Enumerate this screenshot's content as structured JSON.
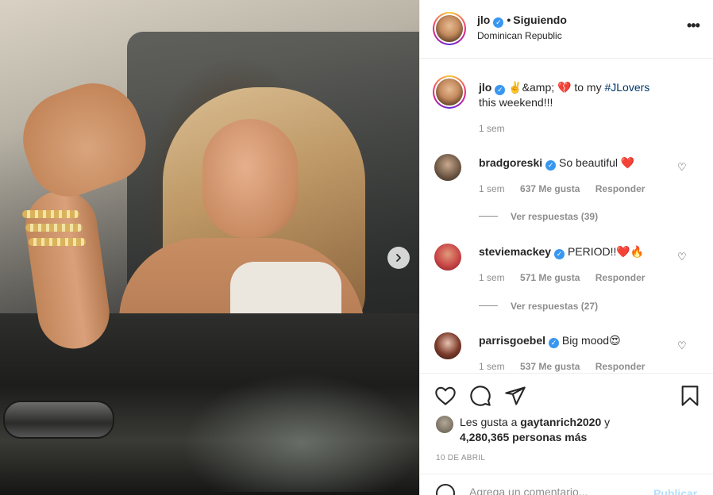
{
  "post": {
    "username": "jlo",
    "following_label": "Siguiendo",
    "location": "Dominican Republic",
    "more_icon": "•••"
  },
  "caption": {
    "username": "jlo",
    "emoji": "✌️&amp; 💔",
    "text_pre": " to my ",
    "hashtag": "#JLovers",
    "text_post": " this weekend!!!",
    "time": "1 sem"
  },
  "comments": [
    {
      "username": "bradgoreski",
      "text": "So beautiful ❤️",
      "time": "1 sem",
      "likes": "637 Me gusta",
      "reply": "Responder",
      "view_replies": "Ver respuestas (39)"
    },
    {
      "username": "steviemackey",
      "text": "PERIOD!!❤️🔥",
      "time": "1 sem",
      "likes": "571 Me gusta",
      "reply": "Responder",
      "view_replies": "Ver respuestas (27)"
    },
    {
      "username": "parrisgoebel",
      "text": "Big mood😍",
      "time": "1 sem",
      "likes": "537 Me gusta",
      "reply": "Responder"
    }
  ],
  "likes": {
    "prefix": "Les gusta a ",
    "user": "gaytanrich2020",
    "suffix": " y",
    "count_line": "4,280,365 personas más"
  },
  "date": "10 DE ABRIL",
  "add_comment": {
    "placeholder": "Agrega un comentario...",
    "publish": "Publicar"
  },
  "icons": {
    "heart": "heart-icon",
    "comment": "comment-icon",
    "share": "share-icon",
    "bookmark": "bookmark-icon",
    "verified": "verified-badge-icon",
    "next": "chevron-right-icon"
  },
  "colors": {
    "verified": "#3897f0",
    "text": "#262626",
    "muted": "#8e8e8e",
    "link": "#00376b",
    "publish_disabled": "#b2dffc"
  }
}
